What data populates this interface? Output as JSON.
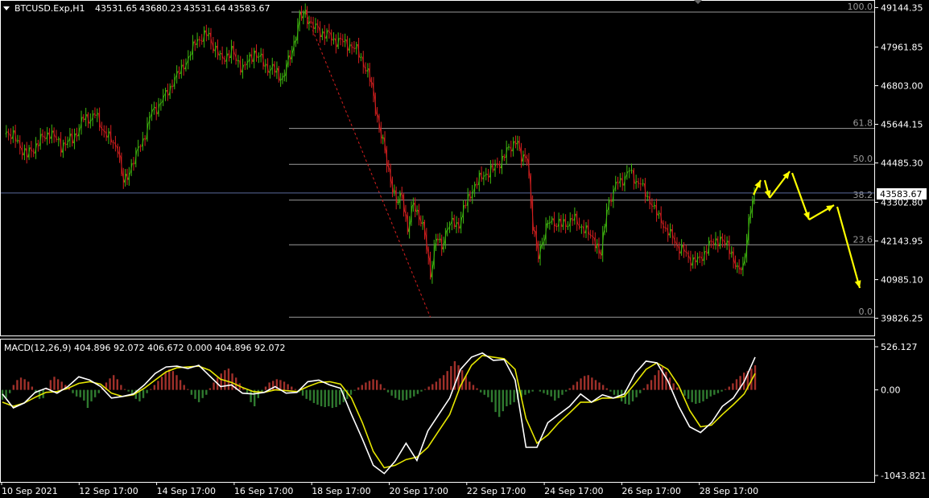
{
  "chart_data": [
    {
      "type": "candlestick",
      "symbol_header": "BTCUSD.Exp,H1",
      "ohlc": [
        "43531.65",
        "43680.23",
        "43531.64",
        "43583.67"
      ],
      "current_price_label": "43583.67",
      "y_ticks": [
        "49144.35",
        "47961.85",
        "46803.00",
        "45644.15",
        "44485.30",
        "43302.80",
        "42143.95",
        "40985.10",
        "39826.25"
      ],
      "x_ticks": [
        "10 Sep 2021",
        "12 Sep 17:00",
        "14 Sep 17:00",
        "16 Sep 17:00",
        "18 Sep 17:00",
        "20 Sep 17:00",
        "22 Sep 17:00",
        "24 Sep 17:00",
        "26 Sep 17:00",
        "28 Sep 17:00"
      ],
      "ylim": [
        39720,
        49180
      ],
      "fibonacci": [
        {
          "label": "100.0",
          "price": 49010
        },
        {
          "label": "61.8",
          "price": 45520
        },
        {
          "label": "50.0",
          "price": 44445
        },
        {
          "label": "38.2",
          "price": 43370
        },
        {
          "label": "23.6",
          "price": 42030
        },
        {
          "label": "0.0",
          "price": 39860
        }
      ],
      "price_path": [
        [
          0,
          45500
        ],
        [
          2,
          45200
        ],
        [
          4,
          44700
        ],
        [
          6,
          45100
        ],
        [
          8,
          45400
        ],
        [
          10,
          45000
        ],
        [
          12,
          45200
        ],
        [
          14,
          45800
        ],
        [
          16,
          45900
        ],
        [
          18,
          45300
        ],
        [
          20,
          44900
        ],
        [
          21,
          43850
        ],
        [
          22,
          44300
        ],
        [
          24,
          45000
        ],
        [
          26,
          46000
        ],
        [
          28,
          46400
        ],
        [
          30,
          47000
        ],
        [
          32,
          47500
        ],
        [
          34,
          48200
        ],
        [
          36,
          48300
        ],
        [
          38,
          47600
        ],
        [
          40,
          47800
        ],
        [
          42,
          47300
        ],
        [
          44,
          47800
        ],
        [
          46,
          47400
        ],
        [
          48,
          47200
        ],
        [
          49,
          47000
        ],
        [
          50,
          47500
        ],
        [
          51,
          48100
        ],
        [
          52,
          48800
        ],
        [
          53,
          49000
        ],
        [
          54,
          48600
        ],
        [
          56,
          48400
        ],
        [
          58,
          48200
        ],
        [
          60,
          48100
        ],
        [
          62,
          47900
        ],
        [
          64,
          47200
        ],
        [
          65,
          46500
        ],
        [
          66,
          45500
        ],
        [
          67,
          44800
        ],
        [
          68,
          44000
        ],
        [
          69,
          43200
        ],
        [
          70,
          43600
        ],
        [
          71,
          42400
        ],
        [
          72,
          43300
        ],
        [
          73,
          42900
        ],
        [
          74,
          42300
        ],
        [
          75,
          41200
        ],
        [
          76,
          42200
        ],
        [
          77,
          42000
        ],
        [
          78,
          42600
        ],
        [
          80,
          42700
        ],
        [
          82,
          43600
        ],
        [
          84,
          44100
        ],
        [
          86,
          44300
        ],
        [
          88,
          44700
        ],
        [
          90,
          45200
        ],
        [
          91,
          44600
        ],
        [
          92,
          44800
        ],
        [
          93,
          42500
        ],
        [
          94,
          41800
        ],
        [
          95,
          42300
        ],
        [
          96,
          42800
        ],
        [
          98,
          42600
        ],
        [
          100,
          42800
        ],
        [
          102,
          42500
        ],
        [
          104,
          42100
        ],
        [
          105,
          41700
        ],
        [
          106,
          43200
        ],
        [
          108,
          43900
        ],
        [
          110,
          44200
        ],
        [
          112,
          43800
        ],
        [
          114,
          43200
        ],
        [
          116,
          42600
        ],
        [
          118,
          42100
        ],
        [
          120,
          41700
        ],
        [
          122,
          41500
        ],
        [
          124,
          42000
        ],
        [
          126,
          42200
        ],
        [
          128,
          41800
        ],
        [
          129,
          41200
        ],
        [
          130,
          41400
        ],
        [
          131,
          42700
        ],
        [
          132,
          43600
        ]
      ],
      "arrows": [
        [
          [
            936,
            242
          ],
          [
            945,
            224
          ]
        ],
        [
          [
            950,
            224
          ],
          [
            956,
            246
          ]
        ],
        [
          [
            956,
            246
          ],
          [
            981,
            213
          ]
        ],
        [
          [
            984,
            215
          ],
          [
            1005,
            273
          ]
        ],
        [
          [
            1005,
            273
          ],
          [
            1036,
            255
          ]
        ],
        [
          [
            1040,
            257
          ],
          [
            1068,
            358
          ]
        ]
      ]
    },
    {
      "type": "macd",
      "label": "MACD(12,26,9) 404.896 92.072 406.672 0.000 404.896 92.072",
      "y_ticks": [
        "526.127",
        "0.00",
        "-1043.821"
      ],
      "ylim": [
        -1043.821,
        526.127
      ],
      "histogram": [
        -120,
        -100,
        -40,
        60,
        120,
        150,
        130,
        100,
        40,
        -40,
        -110,
        -100,
        20,
        120,
        160,
        130,
        100,
        60,
        30,
        -40,
        -80,
        -90,
        -130,
        -220,
        -140,
        -90,
        -40,
        30,
        90,
        140,
        180,
        130,
        60,
        10,
        -20,
        -60,
        -110,
        -140,
        -100,
        -40,
        10,
        60,
        110,
        160,
        210,
        250,
        230,
        180,
        120,
        60,
        10,
        -60,
        -110,
        -150,
        -100,
        -60,
        20,
        90,
        150,
        200,
        240,
        260,
        200,
        150,
        80,
        20,
        -40,
        -150,
        -200,
        -100,
        -20,
        40,
        90,
        110,
        130,
        120,
        100,
        70,
        40,
        10,
        -30,
        -70,
        -110,
        -130,
        -160,
        -180,
        -200,
        -210,
        -200,
        -220,
        -210,
        -180,
        -150,
        -110,
        -60,
        -10,
        30,
        60,
        90,
        110,
        130,
        120,
        70,
        20,
        -30,
        -70,
        -100,
        -120,
        -130,
        -120,
        -100,
        -80,
        -50,
        -20,
        10,
        40,
        70,
        100,
        140,
        180,
        230,
        290,
        350,
        300,
        240,
        170,
        100,
        60,
        20,
        -30,
        -60,
        -90,
        -150,
        -270,
        -330,
        -260,
        -200,
        -180,
        -150,
        -120,
        -90,
        -60,
        -40,
        -20,
        0,
        -20,
        -40,
        -60,
        -80,
        -130,
        -100,
        -60,
        -20,
        20,
        60,
        100,
        140,
        170,
        180,
        150,
        120,
        90,
        60,
        20,
        -20,
        -60,
        -100,
        -140,
        -170,
        -180,
        -140,
        -90,
        -40,
        20,
        70,
        120,
        180,
        240,
        280,
        220,
        150,
        80,
        30,
        -20,
        -70,
        -110,
        -150,
        -170,
        -160,
        -140,
        -110,
        -80,
        -60,
        -40,
        -20,
        10,
        40,
        80,
        130,
        170,
        210,
        230,
        260,
        300
      ],
      "macd_line": [
        -50,
        -220,
        -160,
        -30,
        20,
        -40,
        40,
        160,
        120,
        40,
        -100,
        -80,
        -50,
        60,
        200,
        280,
        290,
        260,
        300,
        170,
        40,
        60,
        -40,
        -50,
        -30,
        40,
        -40,
        -30,
        100,
        120,
        60,
        20,
        -300,
        -600,
        -920,
        -1020,
        -870,
        -650,
        -860,
        -500,
        -300,
        -100,
        250,
        400,
        450,
        360,
        370,
        120,
        -700,
        -700,
        -400,
        -300,
        -200,
        -50,
        -150,
        -60,
        -100,
        -50,
        200,
        350,
        330,
        110,
        -200,
        -450,
        -520,
        -400,
        -200,
        -100,
        100,
        400
      ],
      "signal_line": [
        -150,
        -200,
        -160,
        -90,
        -30,
        -20,
        20,
        80,
        100,
        70,
        -40,
        -80,
        -60,
        20,
        120,
        220,
        270,
        280,
        290,
        240,
        130,
        90,
        30,
        -20,
        -30,
        0,
        -10,
        -20,
        40,
        90,
        100,
        70,
        -100,
        -400,
        -750,
        -950,
        -920,
        -850,
        -820,
        -700,
        -500,
        -300,
        50,
        300,
        420,
        400,
        380,
        250,
        -350,
        -650,
        -550,
        -400,
        -280,
        -150,
        -150,
        -100,
        -100,
        -80,
        80,
        250,
        330,
        250,
        50,
        -250,
        -450,
        -430,
        -300,
        -180,
        -50,
        200
      ],
      "arrows": []
    }
  ],
  "colors": {
    "background": "#000000",
    "bull": "#3fb80f",
    "bear": "#d41f1f",
    "macd_line": "#ffffff",
    "signal_line": "#e6e600",
    "hist_pos": "#a0302a",
    "hist_neg": "#2f7a2f",
    "fib": "#9a9a9a",
    "grid_frame": "#ffffff",
    "arrow": "#ffff00",
    "label_box": "#ffffff"
  }
}
